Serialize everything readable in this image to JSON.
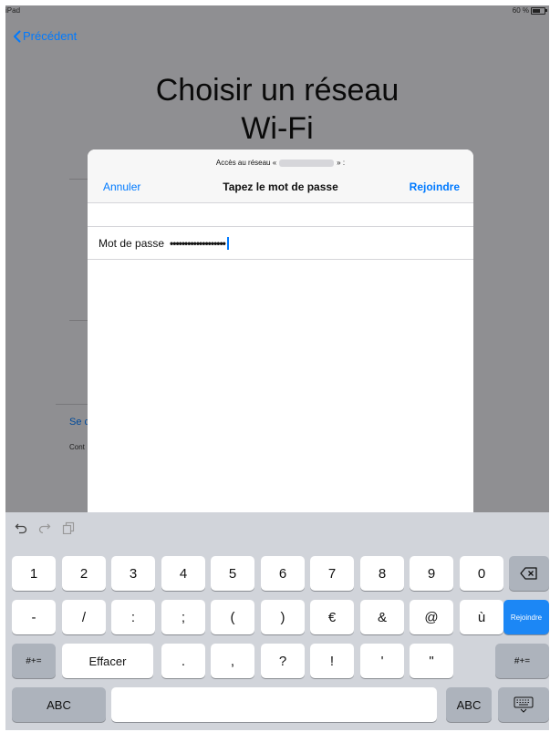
{
  "status": {
    "device": "iPad",
    "battery": "60 %"
  },
  "background": {
    "back_label": "Précédent",
    "title_line1": "Choisir un réseau",
    "title_line2": "Wi-Fi",
    "link_text": "Se c",
    "small_text": "Cont"
  },
  "modal": {
    "subtitle_prefix": "Accès au réseau «",
    "subtitle_suffix": "» :",
    "title": "Tapez le mot de passe",
    "cancel": "Annuler",
    "join": "Rejoindre",
    "field_label": "Mot de passe",
    "field_value": "•••••••••••••••••••"
  },
  "keyboard": {
    "toolbar_icons": [
      "undo-icon",
      "redo-icon",
      "paste-icon"
    ],
    "row1": [
      "1",
      "2",
      "3",
      "4",
      "5",
      "6",
      "7",
      "8",
      "9",
      "0"
    ],
    "row2": [
      "-",
      "/",
      ":",
      ";",
      "(",
      ")",
      "€",
      "&",
      "@",
      "ù"
    ],
    "row3": [
      ".",
      ",",
      "?",
      "!",
      "'",
      "\""
    ],
    "delete_icon": "delete-icon",
    "return_label": "Rejoindre",
    "more_label": "#+=",
    "clear_label": "Effacer",
    "abc_label": "ABC",
    "hide_icon": "keyboard-hide-icon"
  }
}
